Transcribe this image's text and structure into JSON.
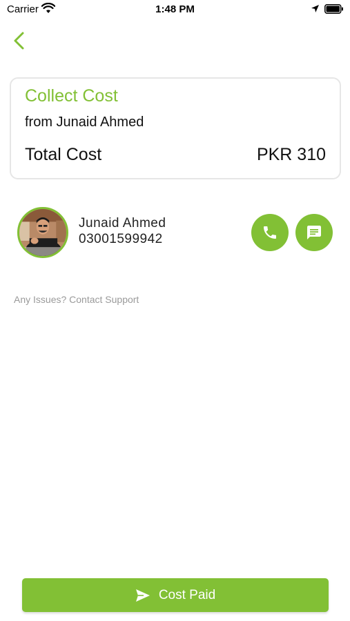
{
  "status_bar": {
    "carrier": "Carrier",
    "time": "1:48 PM"
  },
  "icons": {
    "back": "chevron-left",
    "call": "phone",
    "message": "chat",
    "submit": "send"
  },
  "card": {
    "title": "Collect Cost",
    "from_text": "from Junaid Ahmed",
    "total_label": "Total Cost",
    "total_value": "PKR 310"
  },
  "contact": {
    "name": "Junaid Ahmed",
    "phone": "03001599942"
  },
  "support_text": "Any Issues? Contact Support",
  "action_button": {
    "label": "Cost Paid"
  },
  "colors": {
    "accent": "#82c035",
    "muted_text": "#9a9a9a",
    "card_border": "#e6e6e6"
  }
}
